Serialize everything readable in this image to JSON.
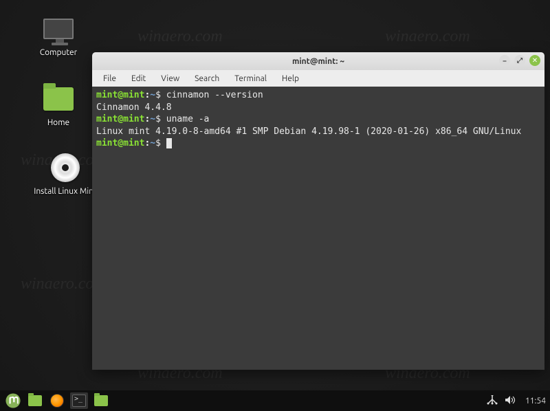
{
  "desktop": {
    "icons": {
      "computer": "Computer",
      "home": "Home",
      "install": "Install Linux Mint"
    }
  },
  "watermark": "winaero.com",
  "terminal_window": {
    "title": "mint@mint: ~",
    "menus": [
      "File",
      "Edit",
      "View",
      "Search",
      "Terminal",
      "Help"
    ],
    "window_controls": {
      "minimize": "–",
      "maximize": "⤢",
      "close": "✕"
    },
    "prompt": {
      "user_host": "mint@mint",
      "separator": ":",
      "path": "~",
      "symbol": "$"
    },
    "lines": {
      "cmd1": "cinnamon --version",
      "out1": "Cinnamon 4.4.8",
      "cmd2": "uname -a",
      "out2": "Linux mint 4.19.0-8-amd64 #1 SMP Debian 4.19.98-1 (2020-01-26) x86_64 GNU/Linux"
    }
  },
  "panel": {
    "tray": {
      "network": "network-icon",
      "sound": "sound-icon"
    },
    "clock": "11:54"
  }
}
